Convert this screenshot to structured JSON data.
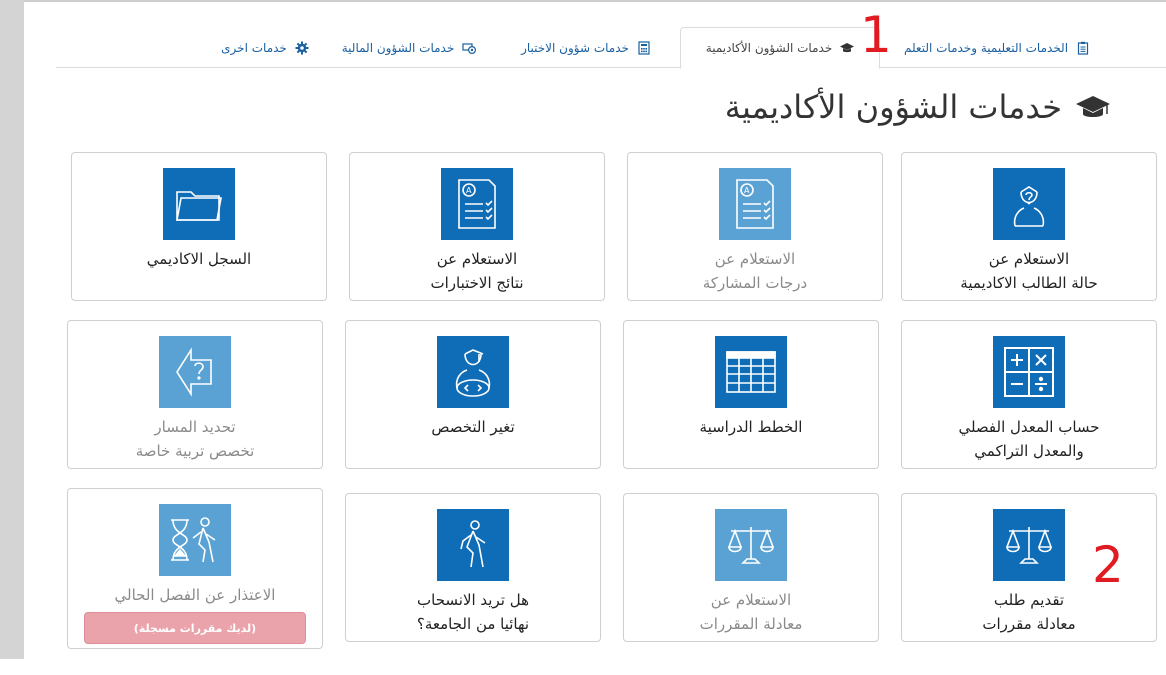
{
  "tabs": [
    {
      "label": "الخدمات التعليمية وخدمات التعلم",
      "icon": "clipboard-icon",
      "active": false
    },
    {
      "label": "خدمات الشؤون الأكاديمية",
      "icon": "graduation-cap-icon",
      "active": true
    },
    {
      "label": "خدمات شؤون الاختبار",
      "icon": "calculator-icon",
      "active": false
    },
    {
      "label": "خدمات الشؤون المالية",
      "icon": "money-icon",
      "active": false
    },
    {
      "label": "خدمات اخرى",
      "icon": "gear-icon",
      "active": false
    }
  ],
  "annotations": {
    "tab_marker": "1",
    "card_marker": "2"
  },
  "header": {
    "title": "خدمات الشؤون الأكاديمية",
    "icon": "graduation-cap-icon"
  },
  "cards": [
    {
      "line1": "الاستعلام عن",
      "line2": "حالة الطالب الاكاديمية",
      "icon": "student-question-icon",
      "enabled": true
    },
    {
      "line1": "الاستعلام عن",
      "line2": "درجات المشاركة",
      "icon": "grade-sheet-icon",
      "enabled": false
    },
    {
      "line1": "الاستعلام عن",
      "line2": "نتائج الاختبارات",
      "icon": "grade-sheet-icon",
      "enabled": true
    },
    {
      "line1": "السجل الاكاديمي",
      "line2": "",
      "icon": "folder-icon",
      "enabled": true
    },
    {
      "line1": "حساب المعدل الفصلي",
      "line2": "والمعدل التراكمي",
      "icon": "calculator-icon",
      "enabled": true
    },
    {
      "line1": "الخطط الدراسية",
      "line2": "",
      "icon": "table-icon",
      "enabled": true
    },
    {
      "line1": "تغير التخصص",
      "line2": "",
      "icon": "student-code-icon",
      "enabled": true
    },
    {
      "line1": "تحديد المسار",
      "line2": "تخصص تربية خاصة",
      "icon": "path-question-icon",
      "enabled": false
    },
    {
      "line1": "تقديم طلب",
      "line2": "معادلة مقررات",
      "icon": "scales-icon",
      "enabled": true
    },
    {
      "line1": "الاستعلام عن",
      "line2": "معادلة المقررات",
      "icon": "scales-icon",
      "enabled": false
    },
    {
      "line1": "هل تريد الانسحاب",
      "line2": "نهائيا من الجامعة؟",
      "icon": "walking-person-icon",
      "enabled": true
    },
    {
      "line1": "الاعتذار عن الفصل الحالي",
      "line2": "",
      "icon": "hourglass-person-icon",
      "enabled": false,
      "badge": "(لديك مقررات مسجلة)"
    }
  ],
  "colors": {
    "tile": "#0f6cb6",
    "tile_disabled": "#5aa2d4",
    "link": "#1a5fa0",
    "annotation": "#e01b22",
    "badge": "#eaa2ab"
  }
}
